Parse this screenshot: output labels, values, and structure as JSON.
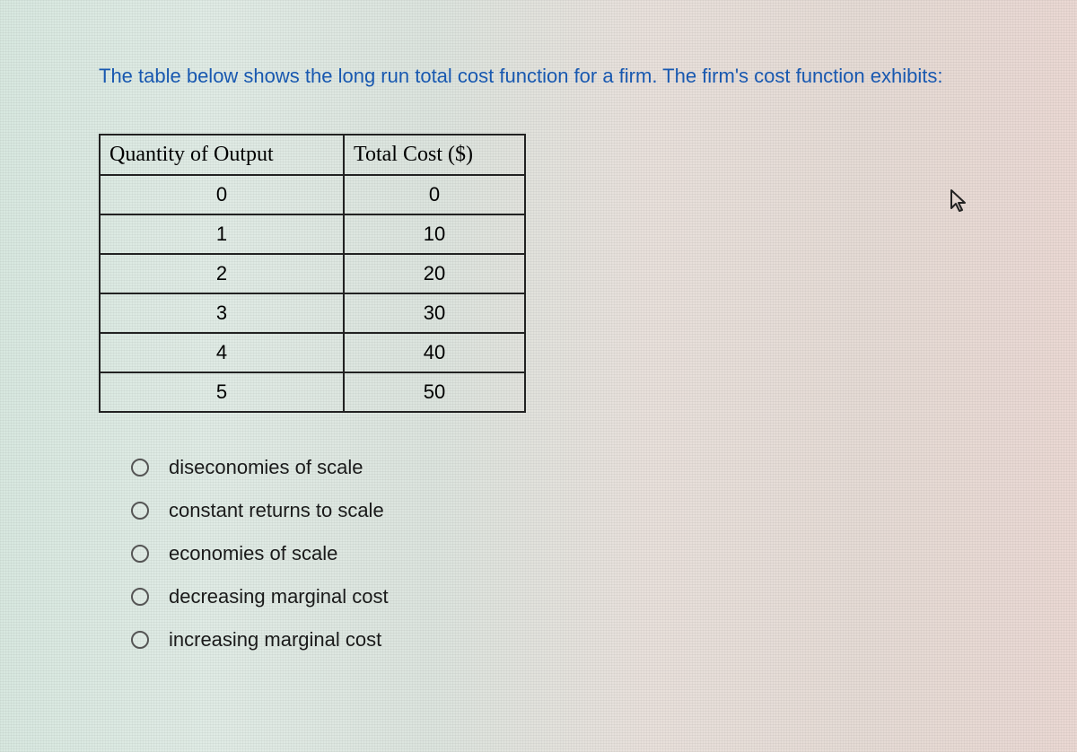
{
  "question_text": "The table below shows the long run total cost function for a firm.  The firm's cost function exhibits:",
  "table": {
    "headers": [
      "Quantity of Output",
      "Total Cost ($)"
    ],
    "rows": [
      {
        "q": "0",
        "c": "0"
      },
      {
        "q": "1",
        "c": "10"
      },
      {
        "q": "2",
        "c": "20"
      },
      {
        "q": "3",
        "c": "30"
      },
      {
        "q": "4",
        "c": "40"
      },
      {
        "q": "5",
        "c": "50"
      }
    ]
  },
  "options": [
    "diseconomies of scale",
    "constant returns to scale",
    "economies of scale",
    "decreasing marginal cost",
    "increasing marginal cost"
  ]
}
